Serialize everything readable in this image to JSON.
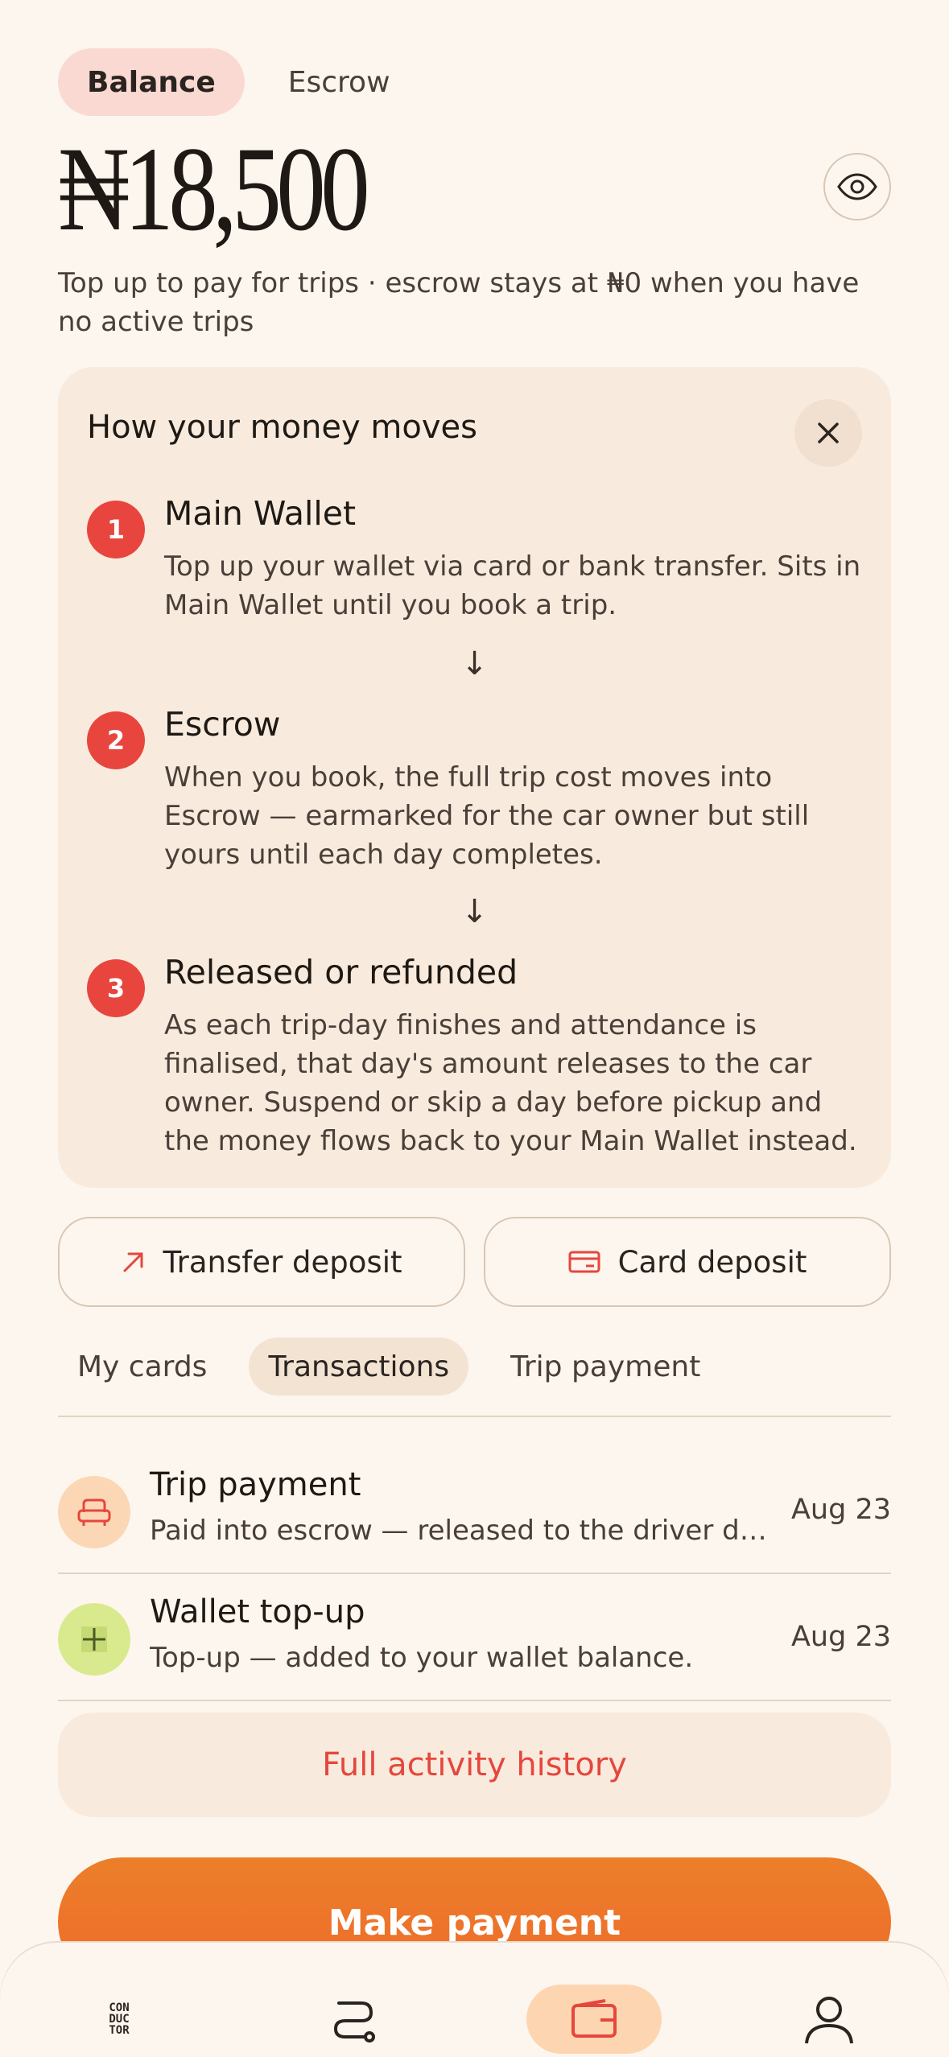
{
  "toggle": {
    "balance": "Balance",
    "escrow": "Escrow"
  },
  "balance": {
    "amount": "₦18,500",
    "note": "Top up to pay for trips · escrow stays at ₦0 when you have no active trips"
  },
  "info_card": {
    "title": "How your money moves",
    "steps": [
      {
        "num": "1",
        "title": "Main Wallet",
        "desc": "Top up your wallet via card or bank transfer. Sits in Main Wallet until you book a trip."
      },
      {
        "num": "2",
        "title": "Escrow",
        "desc": "When you book, the full trip cost moves into Escrow — earmarked for the car owner but still yours until each day completes."
      },
      {
        "num": "3",
        "title": "Released or refunded",
        "desc": "As each trip-day finishes and attendance is finalised, that day's amount releases to the car owner. Suspend or skip a day before pickup and the money flows back to your Main Wallet instead."
      }
    ],
    "arrow": "↓"
  },
  "deposit": {
    "transfer": "Transfer deposit",
    "card": "Card deposit"
  },
  "tabs": [
    "My cards",
    "Transactions",
    "Trip payment"
  ],
  "transactions": [
    {
      "title": "Trip payment",
      "desc": "Paid into escrow — released to the driver daily as trips complete.",
      "date": "Aug 23",
      "icon": "seat-icon"
    },
    {
      "title": "Wallet top-up",
      "desc": "Top-up — added to your wallet balance.",
      "date": "Aug 23",
      "icon": "plus-icon"
    }
  ],
  "history_label": "Full activity history",
  "pay_label": "Make payment",
  "nav": {
    "logo_text": [
      "CON",
      "DUC",
      "TOR"
    ],
    "items": [
      "home-logo-icon",
      "route-icon",
      "wallet-icon",
      "profile-icon"
    ]
  },
  "colors": {
    "accent": "#e8453e",
    "pay": "#ee7a2a",
    "bg": "#fdf6ee"
  }
}
